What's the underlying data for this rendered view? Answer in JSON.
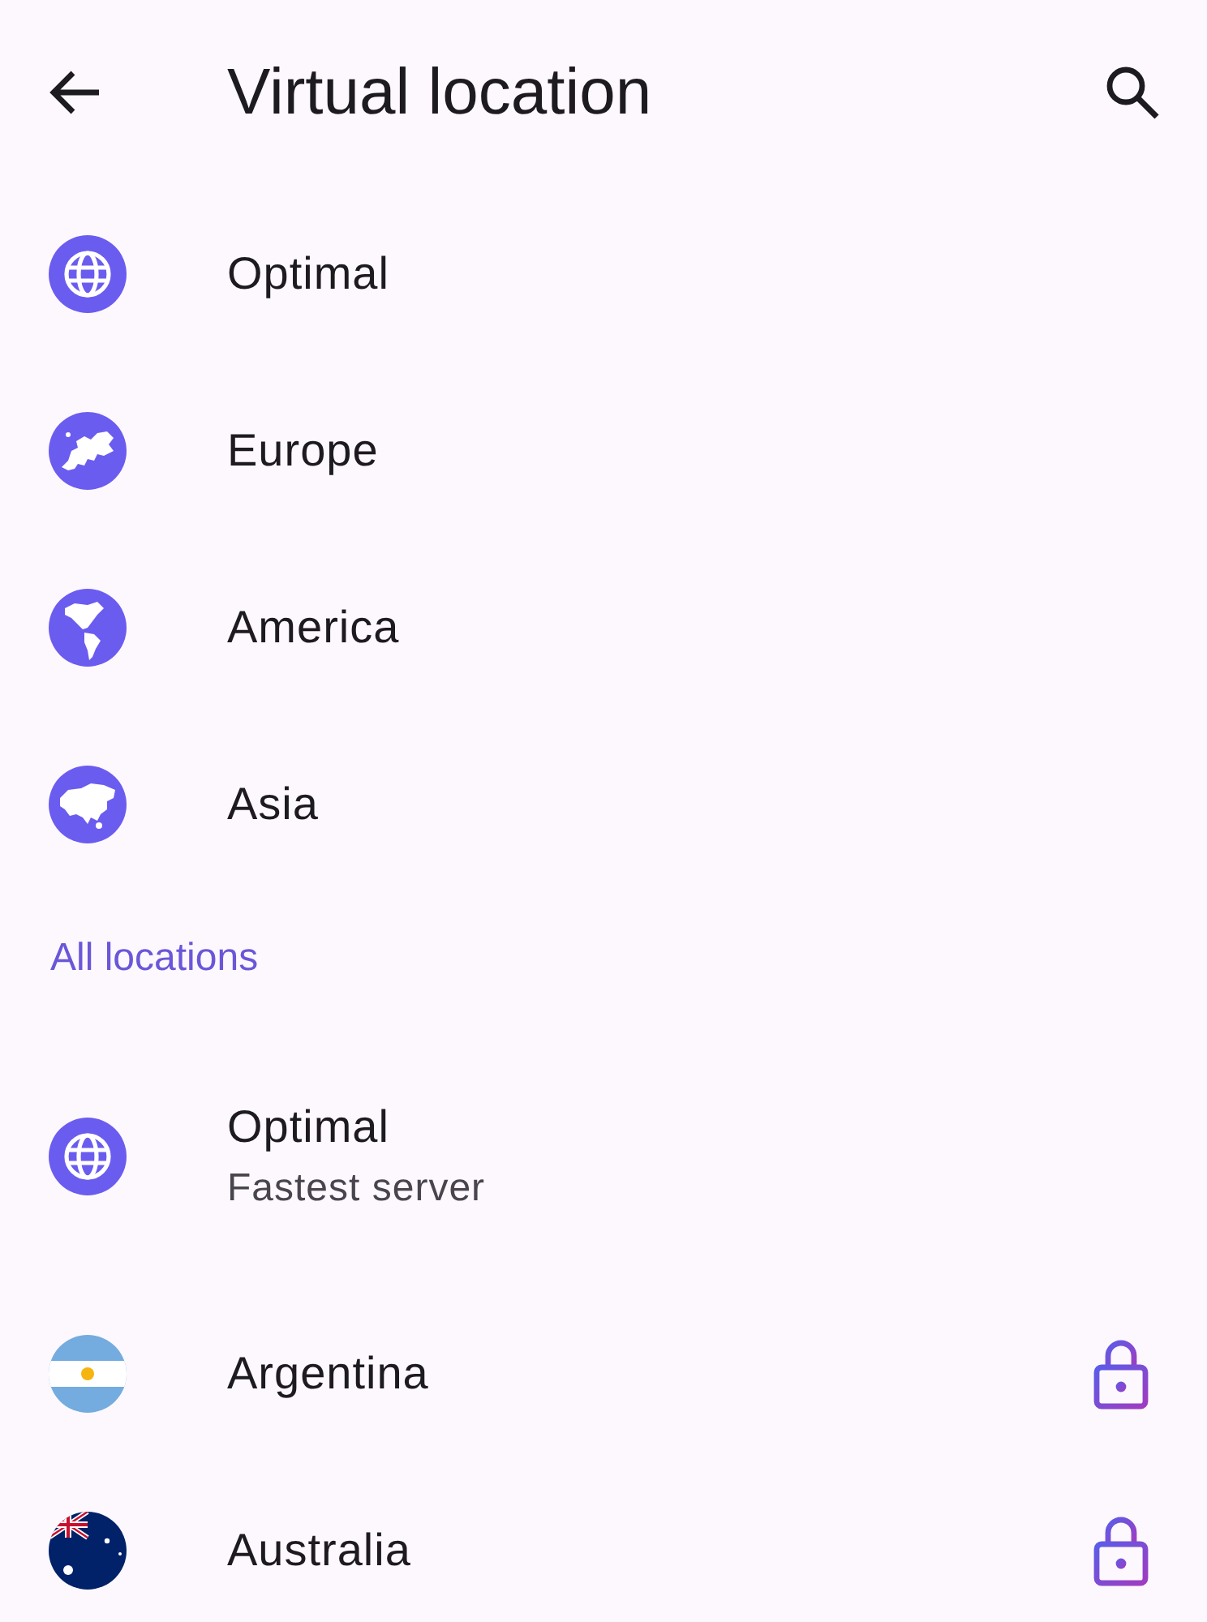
{
  "header": {
    "title": "Virtual location"
  },
  "regions": [
    {
      "kind": "globe",
      "name": "Optimal"
    },
    {
      "kind": "europe",
      "name": "Europe"
    },
    {
      "kind": "america",
      "name": "America"
    },
    {
      "kind": "asia",
      "name": "Asia"
    }
  ],
  "section": {
    "title": "All locations"
  },
  "locations": [
    {
      "kind": "globe",
      "name": "Optimal",
      "subtitle": "Fastest server",
      "locked": false
    },
    {
      "kind": "argentina",
      "name": "Argentina",
      "locked": true
    },
    {
      "kind": "australia",
      "name": "Australia",
      "locked": true
    }
  ]
}
